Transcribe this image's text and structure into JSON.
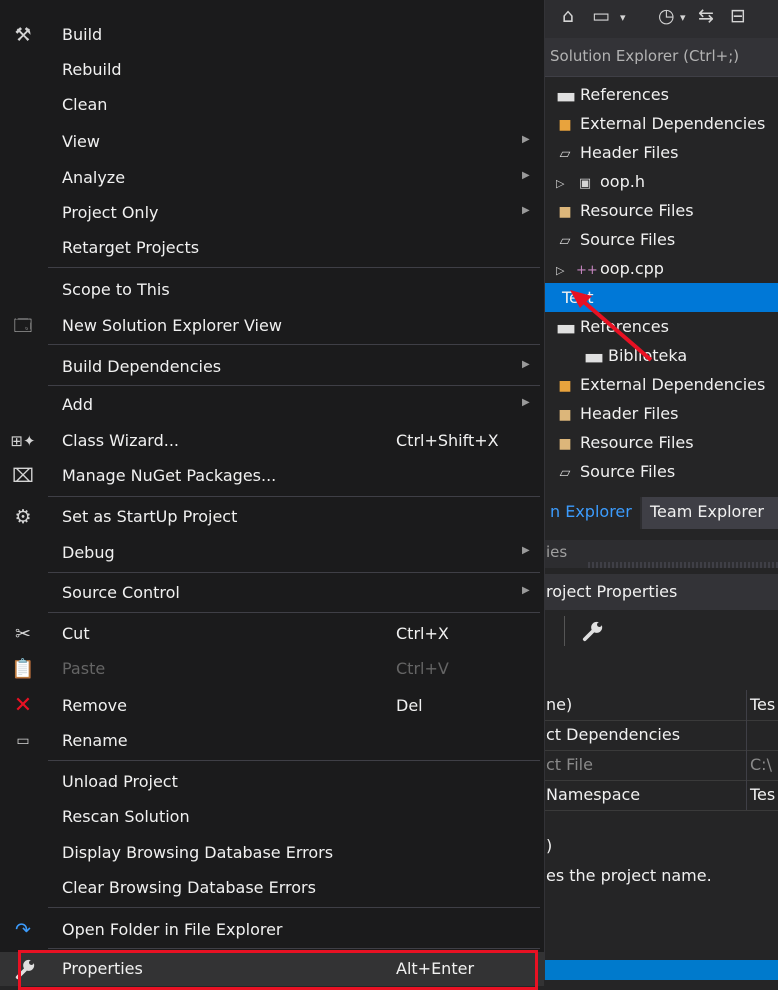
{
  "menu": {
    "items": [
      {
        "label": "Build",
        "icon": "build-icon"
      },
      {
        "label": "Rebuild"
      },
      {
        "label": "Clean"
      },
      {
        "label": "View",
        "submenu": true
      },
      {
        "label": "Analyze",
        "submenu": true
      },
      {
        "label": "Project Only",
        "submenu": true
      },
      {
        "label": "Retarget Projects"
      },
      {
        "label": "Scope to This"
      },
      {
        "label": "New Solution Explorer View",
        "icon": "new-window-icon"
      },
      {
        "label": "Build Dependencies",
        "submenu": true
      },
      {
        "label": "Add",
        "submenu": true
      },
      {
        "label": "Class Wizard...",
        "shortcut": "Ctrl+Shift+X",
        "icon": "class-wizard-icon"
      },
      {
        "label": "Manage NuGet Packages...",
        "icon": "nuget-icon"
      },
      {
        "label": "Set as StartUp Project",
        "icon": "gear-icon"
      },
      {
        "label": "Debug",
        "submenu": true
      },
      {
        "label": "Source Control",
        "submenu": true
      },
      {
        "label": "Cut",
        "shortcut": "Ctrl+X",
        "icon": "scissors-icon"
      },
      {
        "label": "Paste",
        "shortcut": "Ctrl+V",
        "icon": "clipboard-icon",
        "disabled": true
      },
      {
        "label": "Remove",
        "shortcut": "Del",
        "icon": "remove-x-icon"
      },
      {
        "label": "Rename",
        "icon": "rename-icon"
      },
      {
        "label": "Unload Project"
      },
      {
        "label": "Rescan Solution"
      },
      {
        "label": "Display Browsing Database Errors"
      },
      {
        "label": "Clear Browsing Database Errors"
      },
      {
        "label": "Open Folder in File Explorer",
        "icon": "refresh-arrow-icon"
      },
      {
        "label": "Properties",
        "shortcut": "Alt+Enter",
        "icon": "wrench-icon"
      }
    ]
  },
  "solution_explorer": {
    "search_placeholder": "Solution Explorer (Ctrl+;)",
    "tree": [
      {
        "label": "References",
        "icon": "references-icon"
      },
      {
        "label": "External Dependencies",
        "icon": "external-deps-icon"
      },
      {
        "label": "Header Files",
        "icon": "folder-filter-icon"
      },
      {
        "label": "oop.h",
        "icon": "header-file-icon",
        "expander": true
      },
      {
        "label": "Resource Files",
        "icon": "folder-filter-icon"
      },
      {
        "label": "Source Files",
        "icon": "folder-filter-icon"
      },
      {
        "label": "oop.cpp",
        "icon": "cpp-file-icon",
        "expander": true
      },
      {
        "label": "Test",
        "selected": true
      },
      {
        "label": "References",
        "icon": "references-icon"
      },
      {
        "label": "Biblioteka",
        "icon": "references-icon"
      },
      {
        "label": "External Dependencies",
        "icon": "external-deps-icon"
      },
      {
        "label": "Header Files",
        "icon": "folder-filter-icon"
      },
      {
        "label": "Resource Files",
        "icon": "folder-filter-icon"
      },
      {
        "label": "Source Files",
        "icon": "folder-filter-icon"
      }
    ]
  },
  "tabs": {
    "solution_explorer": "n Explorer",
    "team_explorer": "Team Explorer"
  },
  "properties": {
    "title": "ies",
    "header": "roject Properties",
    "rows": [
      {
        "name": "ne)",
        "value": "Tes"
      },
      {
        "name": "ct Dependencies",
        "value": ""
      },
      {
        "name": "ct File",
        "value": "C:\\"
      },
      {
        "name": " Namespace",
        "value": "Tes"
      }
    ],
    "desc_title": ")",
    "desc_text": "es the project name."
  },
  "colors": {
    "accent": "#0078d7",
    "highlight_border": "#e81123",
    "annotation_arrow": "#e81123"
  }
}
